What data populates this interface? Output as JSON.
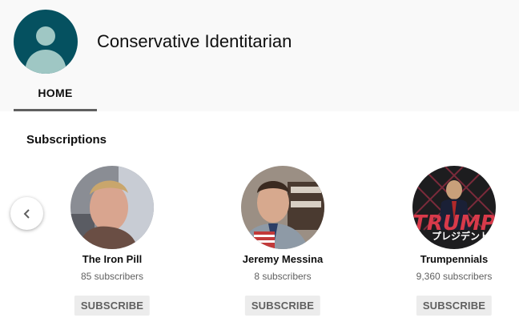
{
  "channel": {
    "title": "Conservative Identitarian",
    "avatar_icon": "default-person-icon",
    "avatar_color": "#055160"
  },
  "tabs": [
    {
      "label": "HOME",
      "active": true
    }
  ],
  "section": {
    "title": "Subscriptions"
  },
  "carousel": {
    "prev_icon": "chevron-left-icon"
  },
  "subscriptions": [
    {
      "name": "The Iron Pill",
      "subscribers": "85 subscribers",
      "button_label": "SUBSCRIBE"
    },
    {
      "name": "Jeremy Messina",
      "subscribers": "8 subscribers",
      "button_label": "SUBSCRIBE"
    },
    {
      "name": "Trumpennials",
      "subscribers": "9,360 subscribers",
      "button_label": "SUBSCRIBE",
      "avatar_text": "TRUMP",
      "avatar_subtext": "プレジデント"
    }
  ]
}
